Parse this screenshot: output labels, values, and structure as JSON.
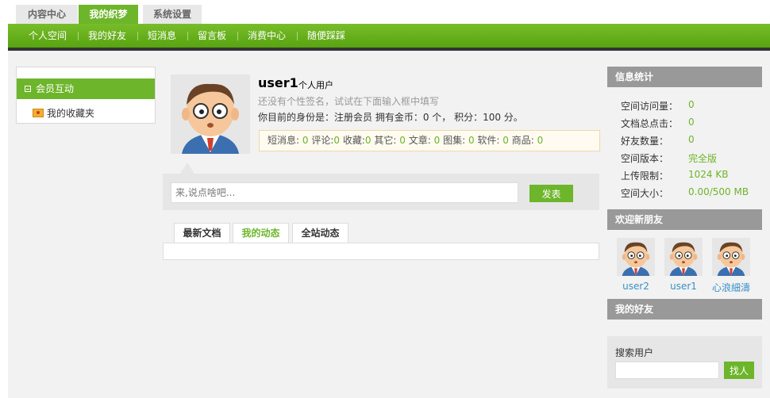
{
  "top_tabs": [
    "内容中心",
    "我的织梦",
    "系统设置"
  ],
  "nav": [
    "个人空间",
    "我的好友",
    "短消息",
    "留言板",
    "消费中心",
    "随便踩踩"
  ],
  "sidebar": {
    "active": "会员互动",
    "item": "我的收藏夹"
  },
  "profile": {
    "username": "user1",
    "usertype": "个人用户",
    "signature": "还没有个性签名，试试在下面输入框中填写",
    "identity": "你目前的身份是：注册会员 拥有金币：0 个， 积分：100 分。",
    "stats": [
      {
        "label": "短消息:",
        "value": "0"
      },
      {
        "label": "评论:",
        "value": "0"
      },
      {
        "label": "收藏:",
        "value": "0"
      },
      {
        "label": "其它:",
        "value": "0"
      },
      {
        "label": "文章:",
        "value": "0"
      },
      {
        "label": "图集:",
        "value": "0"
      },
      {
        "label": "软件:",
        "value": "0"
      },
      {
        "label": "商品:",
        "value": "0"
      }
    ]
  },
  "post": {
    "placeholder": "来,说点啥吧...",
    "button": "发表"
  },
  "content_tabs": [
    "最新文档",
    "我的动态",
    "全站动态"
  ],
  "info": {
    "title": "信息统计",
    "rows": [
      {
        "label": "空间访问量：",
        "value": "0"
      },
      {
        "label": "文档总点击：",
        "value": "0"
      },
      {
        "label": "好友数量：",
        "value": "0"
      },
      {
        "label": "空间版本：",
        "value": "完全版"
      },
      {
        "label": "上传限制：",
        "value": "1024 KB"
      },
      {
        "label": "空间大小：",
        "value": "0.00/500 MB"
      }
    ]
  },
  "new_friends": {
    "title": "欢迎新朋友",
    "users": [
      "user2",
      "user1",
      "心浪細濤"
    ]
  },
  "my_friends": {
    "title": "我的好友"
  },
  "search": {
    "label": "搜索用户",
    "button": "找人"
  }
}
